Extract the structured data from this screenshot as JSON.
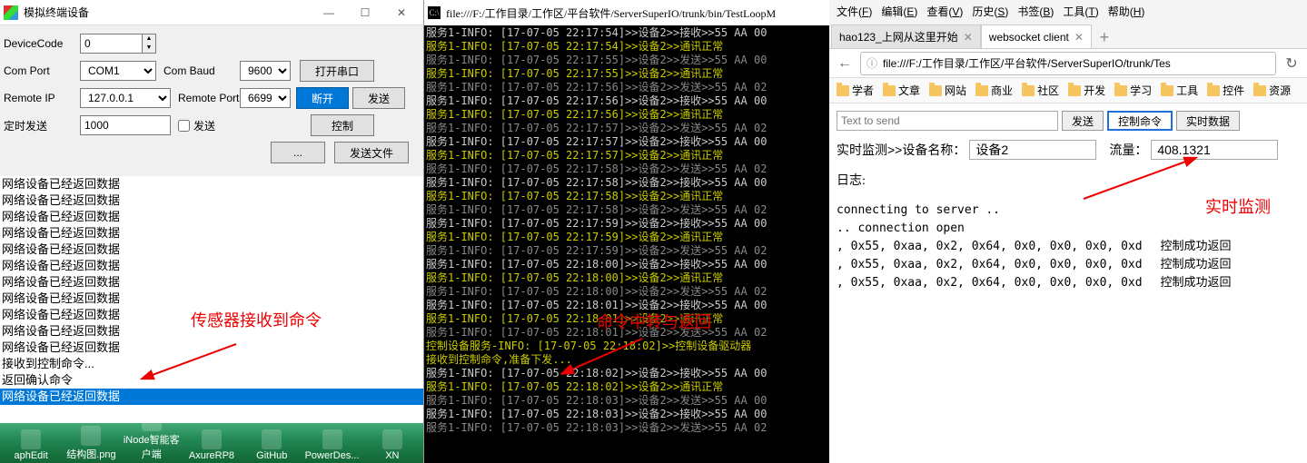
{
  "left": {
    "title": "模拟终端设备",
    "labels": {
      "deviceCode": "DeviceCode",
      "comPort": "Com Port",
      "comBaud": "Com Baud",
      "remoteIp": "Remote IP",
      "remotePort": "Remote Port",
      "timerSend": "定时发送",
      "sendChk": "发送"
    },
    "values": {
      "deviceCode": "0",
      "comPort": "COM1",
      "comBaud": "9600",
      "remoteIp": "127.0.0.1",
      "remotePort": "6699",
      "timerSend": "1000"
    },
    "buttons": {
      "openSerial": "打开串口",
      "disconnect": "断开",
      "send": "发送",
      "control": "控制",
      "browse": "...",
      "sendFile": "发送文件"
    },
    "log": [
      "网络设备已经返回数据",
      "网络设备已经返回数据",
      "网络设备已经返回数据",
      "网络设备已经返回数据",
      "网络设备已经返回数据",
      "网络设备已经返回数据",
      "网络设备已经返回数据",
      "网络设备已经返回数据",
      "网络设备已经返回数据",
      "网络设备已经返回数据",
      "网络设备已经返回数据",
      "接收到控制命令...",
      "返回确认命令"
    ],
    "logHighlighted": "网络设备已经返回数据",
    "annotation": "传感器接收到命令",
    "taskbar": [
      "aphEdit",
      "结构图.png",
      "iNode智能客户端",
      "AxureRP8",
      "GitHub",
      "PowerDes...",
      "XN"
    ]
  },
  "mid": {
    "title": "file:///F:/工作目录/工作区/平台软件/ServerSuperIO/trunk/bin/TestLoopM",
    "lines": [
      "服务1-INFO: [17-07-05 22:17:54]>>设备2>>接收>>55 AA 00",
      "服务1-INFO: [17-07-05 22:17:54]>>设备2>>通讯正常",
      "服务1-INFO: [17-07-05 22:17:55]>>设备2>>发送>>55 AA 00",
      "服务1-INFO: [17-07-05 22:17:55]>>设备2>>通讯正常",
      "服务1-INFO: [17-07-05 22:17:56]>>设备2>>发送>>55 AA 02",
      "服务1-INFO: [17-07-05 22:17:56]>>设备2>>接收>>55 AA 00",
      "服务1-INFO: [17-07-05 22:17:56]>>设备2>>通讯正常",
      "服务1-INFO: [17-07-05 22:17:57]>>设备2>>发送>>55 AA 02",
      "服务1-INFO: [17-07-05 22:17:57]>>设备2>>接收>>55 AA 00",
      "服务1-INFO: [17-07-05 22:17:57]>>设备2>>通讯正常",
      "服务1-INFO: [17-07-05 22:17:58]>>设备2>>发送>>55 AA 02",
      "服务1-INFO: [17-07-05 22:17:58]>>设备2>>接收>>55 AA 00",
      "服务1-INFO: [17-07-05 22:17:58]>>设备2>>通讯正常",
      "服务1-INFO: [17-07-05 22:17:58]>>设备2>>发送>>55 AA 02",
      "服务1-INFO: [17-07-05 22:17:59]>>设备2>>接收>>55 AA 00",
      "服务1-INFO: [17-07-05 22:17:59]>>设备2>>通讯正常",
      "服务1-INFO: [17-07-05 22:17:59]>>设备2>>发送>>55 AA 02",
      "服务1-INFO: [17-07-05 22:18:00]>>设备2>>接收>>55 AA 00",
      "服务1-INFO: [17-07-05 22:18:00]>>设备2>>通讯正常",
      "服务1-INFO: [17-07-05 22:18:00]>>设备2>>发送>>55 AA 02",
      "服务1-INFO: [17-07-05 22:18:01]>>设备2>>接收>>55 AA 00",
      "服务1-INFO: [17-07-05 22:18:01]>>设备2>>通讯正常",
      "服务1-INFO: [17-07-05 22:18:01]>>设备2>>发送>>55 AA 02",
      "控制设备服务-INFO: [17-07-05 22:18:02]>>控制设备驱动器",
      "接收到控制命令,准备下发...",
      "服务1-INFO: [17-07-05 22:18:02]>>设备2>>接收>>55 AA 00",
      "服务1-INFO: [17-07-05 22:18:02]>>设备2>>通讯正常",
      "服务1-INFO: [17-07-05 22:18:03]>>设备2>>发送>>55 AA 00",
      "服务1-INFO: [17-07-05 22:18:03]>>设备2>>接收>>55 AA 00",
      "服务1-INFO: [17-07-05 22:18:03]>>设备2>>发送>>55 AA 02"
    ],
    "annotation": "命令中转与返回"
  },
  "right": {
    "menu": [
      "文件(F)",
      "编辑(E)",
      "查看(V)",
      "历史(S)",
      "书签(B)",
      "工具(T)",
      "帮助(H)"
    ],
    "tabs": [
      {
        "label": "hao123_上网从这里开始",
        "active": false
      },
      {
        "label": "websocket client",
        "active": true
      }
    ],
    "url": "file:///F:/工作目录/工作区/平台软件/ServerSuperIO/trunk/Tes",
    "bookmarks": [
      "学者",
      "文章",
      "网站",
      "商业",
      "社区",
      "开发",
      "学习",
      "工具",
      "控件",
      "资源"
    ],
    "sendPlaceholder": "Text to send",
    "buttons": {
      "send": "发送",
      "ctrl": "控制命令",
      "realtime": "实时数据"
    },
    "monitor": {
      "prefix": "实时监测>>设备名称：",
      "device": "设备2",
      "flowLabel": "流量：",
      "flow": "408.1321"
    },
    "logTitle": "日志:",
    "logLines": [
      "connecting to server ..",
      ".. connection open"
    ],
    "dataRows": [
      {
        "bytes": ", 0x55, 0xaa, 0x2, 0x64, 0x0, 0x0, 0x0, 0xd",
        "msg": "控制成功返回"
      },
      {
        "bytes": ", 0x55, 0xaa, 0x2, 0x64, 0x0, 0x0, 0x0, 0xd",
        "msg": "控制成功返回"
      },
      {
        "bytes": ", 0x55, 0xaa, 0x2, 0x64, 0x0, 0x0, 0x0, 0xd",
        "msg": "控制成功返回"
      }
    ],
    "annotation": "实时监测"
  }
}
